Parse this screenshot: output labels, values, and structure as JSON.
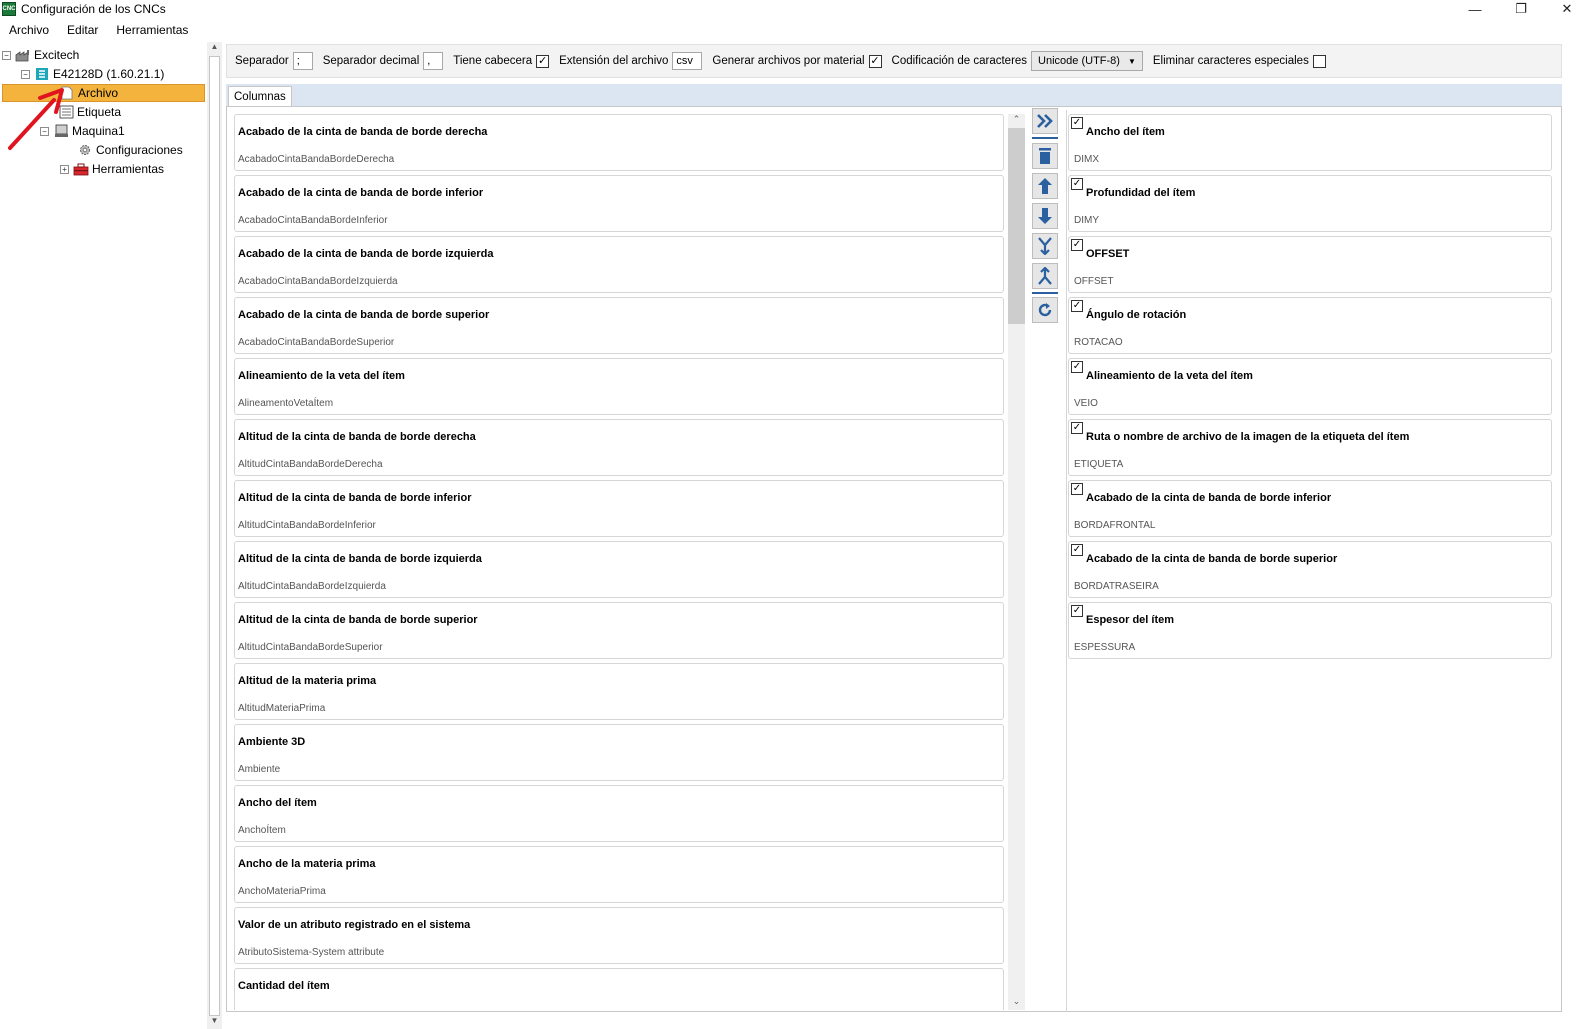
{
  "window": {
    "title": "Configuración de los CNCs",
    "icon_text": "CNC",
    "minimize": "—",
    "restore": "❐",
    "close": "✕"
  },
  "menu": [
    "Archivo",
    "Editar",
    "Herramientas"
  ],
  "tree": {
    "nodes": [
      {
        "label": "Excitech",
        "icon": "factory-icon",
        "expander": "−"
      },
      {
        "label": "E42128D (1.60.21.1)",
        "icon": "app-node-icon",
        "expander": "−"
      },
      {
        "label": "Archivo",
        "icon": "file-icon",
        "selected": true
      },
      {
        "label": "Etiqueta",
        "icon": "label-icon"
      },
      {
        "label": "Maquina1",
        "icon": "machine-icon",
        "expander": "−"
      },
      {
        "label": "Configuraciones",
        "icon": "gear-icon"
      },
      {
        "label": "Herramientas",
        "icon": "toolbox-icon",
        "expander": "+"
      }
    ]
  },
  "toolbar": {
    "separator_label": "Separador",
    "separator_value": ";",
    "decimal_label": "Separador decimal",
    "decimal_value": ",",
    "header_label": "Tiene cabecera",
    "header_checked": true,
    "extension_label": "Extensión del archivo",
    "extension_value": "csv",
    "per_material_label": "Generar archivos por material",
    "per_material_checked": true,
    "encoding_label": "Codificación de caracteres",
    "encoding_value": "Unicode (UTF-8)",
    "special_chars_label": "Eliminar caracteres especiales",
    "special_chars_checked": false
  },
  "tabs": [
    "Columnas"
  ],
  "available_columns": [
    {
      "title": "Acabado de la cinta de banda de borde derecha",
      "key": "AcabadoCintaBandaBordeDerecha"
    },
    {
      "title": "Acabado de la cinta de banda de borde inferior",
      "key": "AcabadoCintaBandaBordeInferior"
    },
    {
      "title": "Acabado de la cinta de banda de borde izquierda",
      "key": "AcabadoCintaBandaBordeIzquierda"
    },
    {
      "title": "Acabado de la cinta de banda de borde superior",
      "key": "AcabadoCintaBandaBordeSuperior"
    },
    {
      "title": "Alineamiento de la veta del ítem",
      "key": "AlineamentoVetaÍtem"
    },
    {
      "title": "Altitud de la cinta de banda de borde derecha",
      "key": "AltitudCintaBandaBordeDerecha"
    },
    {
      "title": "Altitud de la cinta de banda de borde inferior",
      "key": "AltitudCintaBandaBordeInferior"
    },
    {
      "title": "Altitud de la cinta de banda de borde izquierda",
      "key": "AltitudCintaBandaBordeIzquierda"
    },
    {
      "title": "Altitud de la cinta de banda de borde superior",
      "key": "AltitudCintaBandaBordeSuperior"
    },
    {
      "title": "Altitud de la materia prima",
      "key": "AltitudMateriaPrima"
    },
    {
      "title": "Ambiente 3D",
      "key": "Ambiente"
    },
    {
      "title": "Ancho del ítem",
      "key": "AnchoÍtem"
    },
    {
      "title": "Ancho de la materia prima",
      "key": "AnchoMateriaPrima"
    },
    {
      "title": "Valor de un atributo registrado en el sistema",
      "key": "AtributoSistema-System attribute"
    },
    {
      "title": "Cantidad del ítem",
      "key": ""
    }
  ],
  "actions": [
    "add-all-icon",
    "delete-icon",
    "move-up-icon",
    "move-down-icon",
    "merge-icon",
    "split-icon",
    "refresh-icon"
  ],
  "selected_columns": [
    {
      "title": "Ancho del ítem",
      "key": "DIMX",
      "checked": true
    },
    {
      "title": "Profundidad del ítem",
      "key": "DIMY",
      "checked": true
    },
    {
      "title": "OFFSET",
      "key": "OFFSET",
      "checked": true
    },
    {
      "title": "Ángulo de rotación",
      "key": "ROTACAO",
      "checked": true
    },
    {
      "title": "Alineamiento de la veta del ítem",
      "key": "VEIO",
      "checked": true
    },
    {
      "title": "Ruta o nombre de archivo de la imagen de la etiqueta del ítem",
      "key": "ETIQUETA",
      "checked": true
    },
    {
      "title": "Acabado de la cinta de banda de borde inferior",
      "key": "BORDAFRONTAL",
      "checked": true
    },
    {
      "title": "Acabado de la cinta de banda de borde superior",
      "key": "BORDATRASEIRA",
      "checked": true
    },
    {
      "title": "Espesor del ítem",
      "key": "ESPESSURA",
      "checked": true
    }
  ],
  "colors": {
    "selection": "#f3b33d",
    "tabstrip": "#dbe6f2",
    "action_icon": "#2a5fa0",
    "annotation": "#e0141e"
  }
}
